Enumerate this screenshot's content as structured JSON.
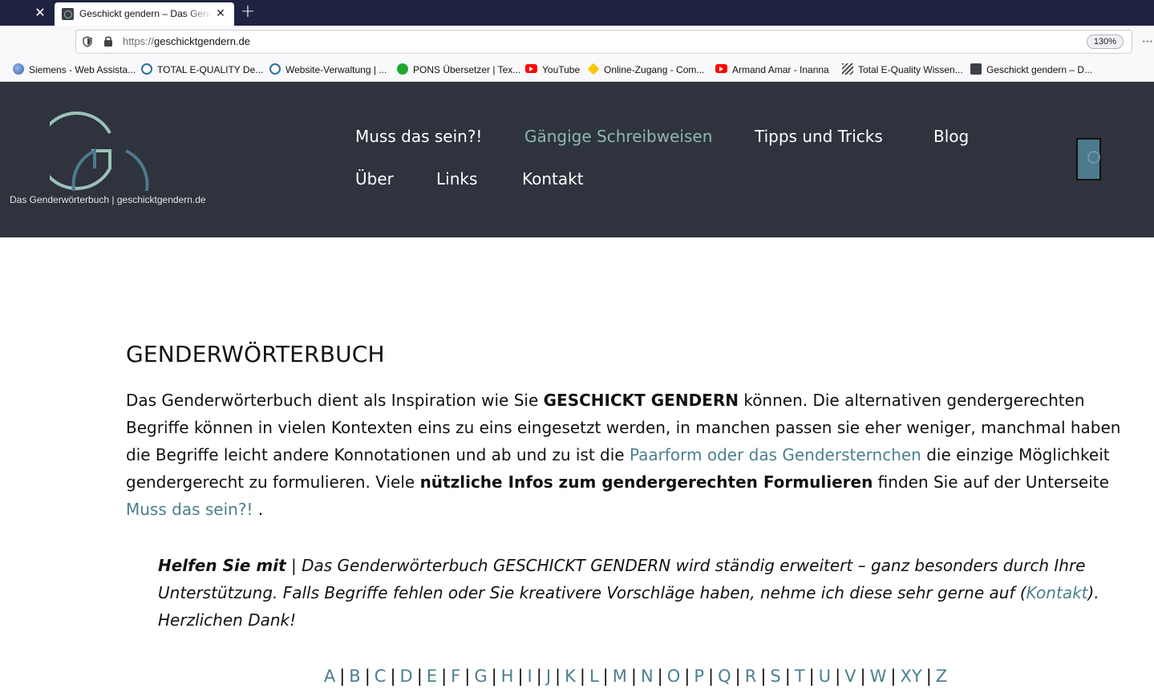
{
  "browser": {
    "tab": {
      "title": "Geschickt gendern – Das Genderwörterbuch"
    },
    "url": {
      "protocol": "https://",
      "host": "geschicktgendern.de"
    },
    "zoom": "130%",
    "bookmarks": [
      {
        "label": "Siemens - Web Assista...",
        "icon": "globe-icon"
      },
      {
        "label": "TOTAL E-QUALITY De...",
        "icon": "search-icon"
      },
      {
        "label": "Website-Verwaltung | ...",
        "icon": "search-icon"
      },
      {
        "label": "PONS Übersetzer | Tex...",
        "icon": "pons-icon"
      },
      {
        "label": "YouTube",
        "icon": "youtube-icon"
      },
      {
        "label": "Online-Zugang - Com...",
        "icon": "commerzbank-icon"
      },
      {
        "label": "Armand Amar - Inanna",
        "icon": "youtube-icon"
      },
      {
        "label": "Total E-Quality Wissen...",
        "icon": "document-icon"
      },
      {
        "label": "Geschickt gendern – D...",
        "icon": "geschickt-gendern-icon"
      }
    ]
  },
  "site": {
    "logo_text": "Das Genderwörterbuch | geschicktgendern.de",
    "logo_colors": {
      "outer_ring": "#9cc2b8",
      "inner_ring": "#4b7b8c"
    },
    "menu": {
      "muss": "Muss das sein?!",
      "gaengige": "Gängige Schreibweisen",
      "tipps": "Tipps und Tricks",
      "blog": "Blog",
      "ueber": "Über",
      "links": "Links",
      "kontakt": "Kontakt"
    },
    "accent_color": "#4b7f8f",
    "header_bg": "#2e333d"
  },
  "content": {
    "title": "GENDERWÖRTERBUCH",
    "intro": {
      "t1": "Das Genderwörterbuch dient als Inspiration wie Sie ",
      "b1": "GESCHICKT GENDERN",
      "t2": " können. Die alternativen gendergerechten Begriffe können in vielen Kontexten eins zu eins eingesetzt werden, in manchen passen sie eher weniger, manchmal haben die Begriffe leicht andere Konnotationen und ab und zu ist die ",
      "l1": "Paarform oder das Gendersternchen",
      "t3": " die einzige Möglichkeit gendergerecht zu formulieren. Viele ",
      "b2": "nützliche Infos zum gendergerechten Formulieren",
      "t4": " finden Sie auf der Unterseite ",
      "l2": "Muss das sein?!",
      "t5": " ."
    },
    "help": {
      "b": "Helfen Sie mit",
      "t1": " | Das Genderwörterbuch GESCHICKT GENDERN wird ständig erweitert – ganz besonders durch Ihre Unterstützung. Falls Begriffe fehlen oder Sie kreativere Vorschläge haben, nehme ich diese sehr gerne auf (",
      "link": "Kontakt",
      "t2": "). Herzlichen Dank!"
    },
    "alphabet": [
      "A",
      "B",
      "C",
      "D",
      "E",
      "F",
      "G",
      "H",
      "I",
      "J",
      "K",
      "L",
      "M",
      "N",
      "O",
      "P",
      "Q",
      "R",
      "S",
      "T",
      "U",
      "V",
      "W",
      "XY",
      "Z"
    ],
    "separator": "|"
  }
}
